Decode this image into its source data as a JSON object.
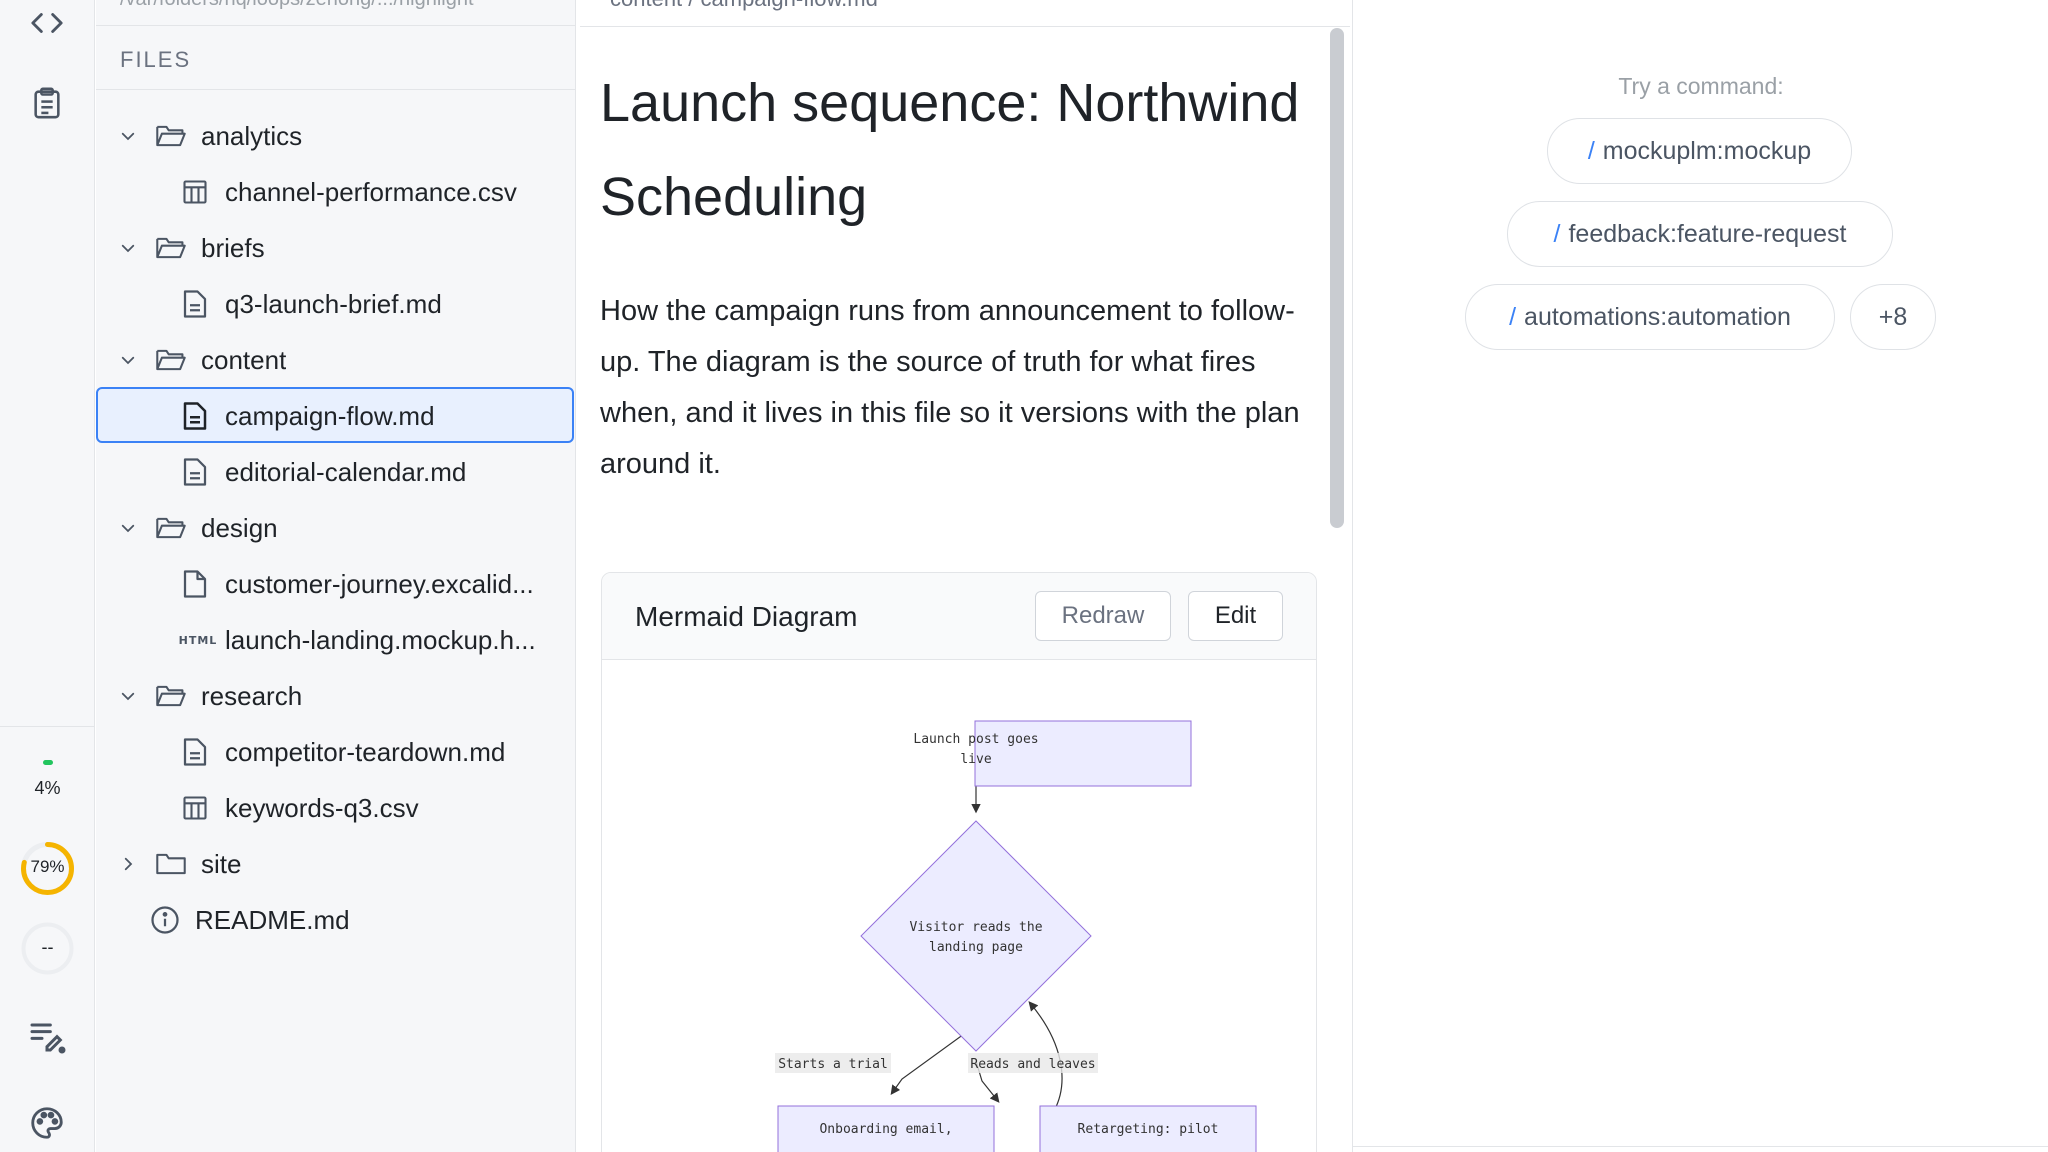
{
  "rail": {
    "gauge_small": "4%",
    "gauge_ring": "79%",
    "gauge_blank": "--",
    "colors": {
      "ring": "#f5b400",
      "dot": "#22c55e"
    }
  },
  "files": {
    "path": "/var/folders/hq/loops/zehong/.../highlight",
    "header": "FILES",
    "tree": [
      {
        "label": "analytics",
        "kind": "folder",
        "open": true
      },
      {
        "label": "channel-performance.csv",
        "kind": "table"
      },
      {
        "label": "briefs",
        "kind": "folder",
        "open": true
      },
      {
        "label": "q3-launch-brief.md",
        "kind": "doc"
      },
      {
        "label": "content",
        "kind": "folder",
        "open": true
      },
      {
        "label": "campaign-flow.md",
        "kind": "doc",
        "selected": true
      },
      {
        "label": "editorial-calendar.md",
        "kind": "doc"
      },
      {
        "label": "design",
        "kind": "folder",
        "open": true
      },
      {
        "label": "customer-journey.excalid...",
        "kind": "file"
      },
      {
        "label": "launch-landing.mockup.h...",
        "kind": "html",
        "badge": "HTML"
      },
      {
        "label": "research",
        "kind": "folder",
        "open": true
      },
      {
        "label": "competitor-teardown.md",
        "kind": "doc"
      },
      {
        "label": "keywords-q3.csv",
        "kind": "table"
      },
      {
        "label": "site",
        "kind": "folder",
        "open": false
      },
      {
        "label": "README.md",
        "kind": "info"
      }
    ]
  },
  "editor": {
    "breadcrumb": "content / campaign-flow.md",
    "title": "Launch sequence: Northwind Scheduling",
    "paragraph": "How the campaign runs from announcement to follow-up. The diagram is the source of truth for what fires when, and it lives in this file so it versions with the plan around it.",
    "mermaid": {
      "title": "Mermaid Diagram",
      "redraw": "Redraw",
      "edit": "Edit",
      "nodes": {
        "launch_1": "Launch post goes",
        "launch_2": "live",
        "visitor_1": "Visitor reads the",
        "visitor_2": "landing page",
        "onboarding": "Onboarding email,",
        "retargeting": "Retargeting: pilot"
      },
      "edges": {
        "trial": "Starts a trial",
        "leaves": "Reads and leaves"
      }
    }
  },
  "right": {
    "try": "Try a command:",
    "commands": [
      "mockuplm:mockup",
      "feedback:feature-request",
      "automations:automation"
    ],
    "more": "+8",
    "slash": "/"
  }
}
